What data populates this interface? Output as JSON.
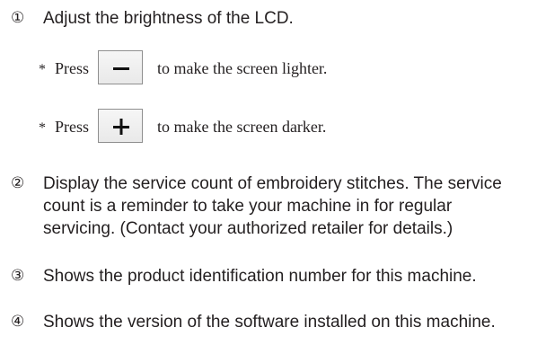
{
  "items": [
    {
      "marker": "①",
      "text": "Adjust the brightness of the LCD."
    },
    {
      "marker": "②",
      "text": "Display the service count of embroidery stitches. The service count is a reminder to take your machine in for regular servicing. (Contact your authorized retailer for details.)"
    },
    {
      "marker": "③",
      "text": "Shows the product identification number for this machine."
    },
    {
      "marker": "④",
      "text": "Shows the version of the software installed on this machine."
    }
  ],
  "notes": [
    {
      "bullet": "*",
      "press": "Press",
      "key_icon": "minus-key-icon",
      "text": "to make the screen lighter."
    },
    {
      "bullet": "*",
      "press": "Press",
      "key_icon": "plus-key-icon",
      "text": "to make the screen darker."
    }
  ]
}
